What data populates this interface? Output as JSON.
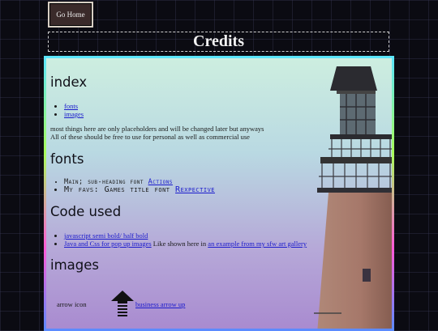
{
  "nav": {
    "go_home": "Go Home"
  },
  "header": {
    "title": "Credits"
  },
  "index": {
    "heading": "index",
    "links": [
      "fonts",
      "images"
    ],
    "note_line1": "most things here are only placeholders and will be changed later but anyways",
    "note_line2": "All of these should be free to use for personal as well as commercial use"
  },
  "fonts": {
    "heading": "fonts",
    "item1_prefix": "Main; sub-heading font",
    "item1_link": "Actions",
    "item2_prefix": "My favs: Games title font",
    "item2_link": "Rexpective"
  },
  "code": {
    "heading": "Code used",
    "item1_link": "javascript semi bold/ half bold",
    "item2_link": "Java and Css for pop up images",
    "item2_text": " Like shown here in ",
    "item2_link2": "an example from my sfw art gallery"
  },
  "images": {
    "heading": "images",
    "arrow_label": "arrow icon",
    "arrow_link": "business arrow up"
  }
}
